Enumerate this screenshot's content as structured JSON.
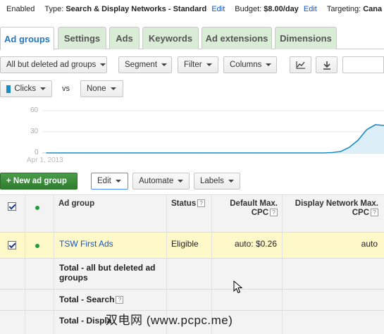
{
  "summary": {
    "status": "Enabled",
    "type_label": "Type:",
    "type_value": "Search & Display Networks - Standard",
    "type_edit": "Edit",
    "budget_label": "Budget:",
    "budget_value": "$8.00/day",
    "budget_edit": "Edit",
    "targeting_label": "Targeting:",
    "targeting_value": "Cana"
  },
  "tabs": [
    "Ad groups",
    "Settings",
    "Ads",
    "Keywords",
    "Ad extensions",
    "Dimensions"
  ],
  "toolbar": {
    "filter_select": "All but deleted ad groups",
    "segment": "Segment",
    "filter": "Filter",
    "columns": "Columns"
  },
  "metric": {
    "primary": "Clicks",
    "vs": "vs",
    "secondary": "None",
    "primary_color": "#1a8bc9"
  },
  "chart_data": {
    "type": "area",
    "y_ticks": [
      "60",
      "30",
      "0"
    ],
    "ylim": [
      0,
      60
    ],
    "x_start_label": "Apr 1, 2013",
    "series": [
      {
        "values": [
          0,
          0,
          0,
          0,
          0,
          0,
          0,
          0,
          0,
          0,
          0,
          0,
          0,
          0,
          0,
          0,
          0,
          0,
          0,
          0,
          0,
          0,
          0,
          0,
          0,
          0,
          0,
          0,
          0,
          0,
          0,
          0,
          0,
          0.5,
          2,
          8,
          18,
          33,
          40,
          39
        ]
      }
    ]
  },
  "actions": {
    "new_ad_group": "+ New ad group",
    "edit": "Edit",
    "automate": "Automate",
    "labels": "Labels"
  },
  "table": {
    "headers": {
      "ad_group": "Ad group",
      "status": "Status",
      "default_cpc": "Default Max. CPC",
      "display_cpc": "Display Network Max. CPC"
    },
    "rows": [
      {
        "ad_group": "TSW First Ads",
        "status": "Eligible",
        "default_cpc": "auto: $0.26",
        "display_cpc": "auto"
      }
    ],
    "totals": [
      "Total - all but deleted ad groups",
      "Total - Search",
      "Total - Displa"
    ]
  },
  "watermark": "双电网 (www.pcpc.me)"
}
